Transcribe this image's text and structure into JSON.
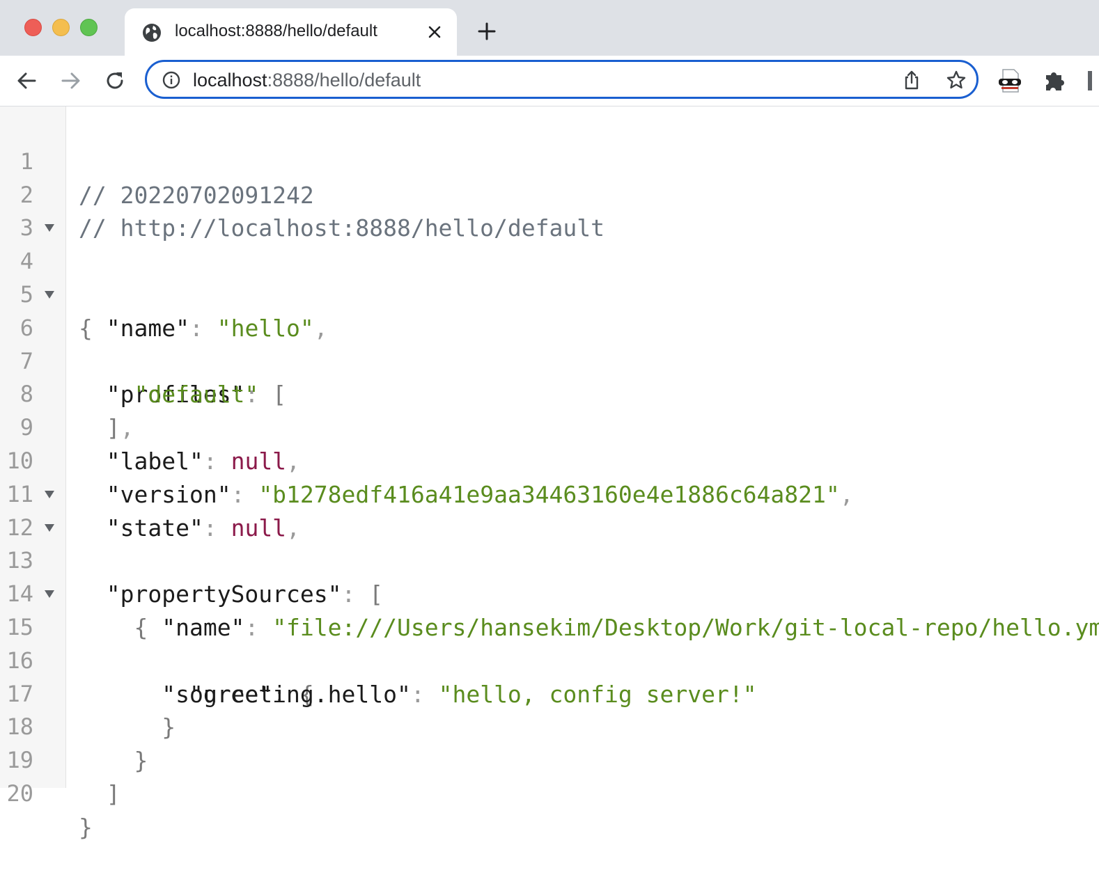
{
  "browser": {
    "tab": {
      "title": "localhost:8888/hello/default"
    },
    "address_bar": {
      "host": "localhost",
      "rest": ":8888/hello/default"
    }
  },
  "viewer": {
    "line_numbers": [
      "1",
      "2",
      "3",
      "4",
      "5",
      "6",
      "7",
      "8",
      "9",
      "10",
      "11",
      "12",
      "13",
      "14",
      "15",
      "16",
      "17",
      "18",
      "19",
      "20"
    ],
    "comment_timestamp": "// 20220702091242",
    "comment_url": "// http://localhost:8888/hello/default",
    "json": {
      "name_key": "\"name\"",
      "name_value": "\"hello\"",
      "profiles_key": "\"profiles\"",
      "profiles_value_0": "\"default\"",
      "label_key": "\"label\"",
      "label_value": "null",
      "version_key": "\"version\"",
      "version_value": "\"b1278edf416a41e9aa34463160e4e1886c64a821\"",
      "state_key": "\"state\"",
      "state_value": "null",
      "propertySources_key": "\"propertySources\"",
      "ps_name_key": "\"name\"",
      "ps_name_value": "\"file:///Users/hansekim/Desktop/Work/git-local-repo/hello.yml\"",
      "ps_source_key": "\"source\"",
      "greeting_key": "\"greeting.hello\"",
      "greeting_value": "\"hello, config server!\""
    }
  }
}
